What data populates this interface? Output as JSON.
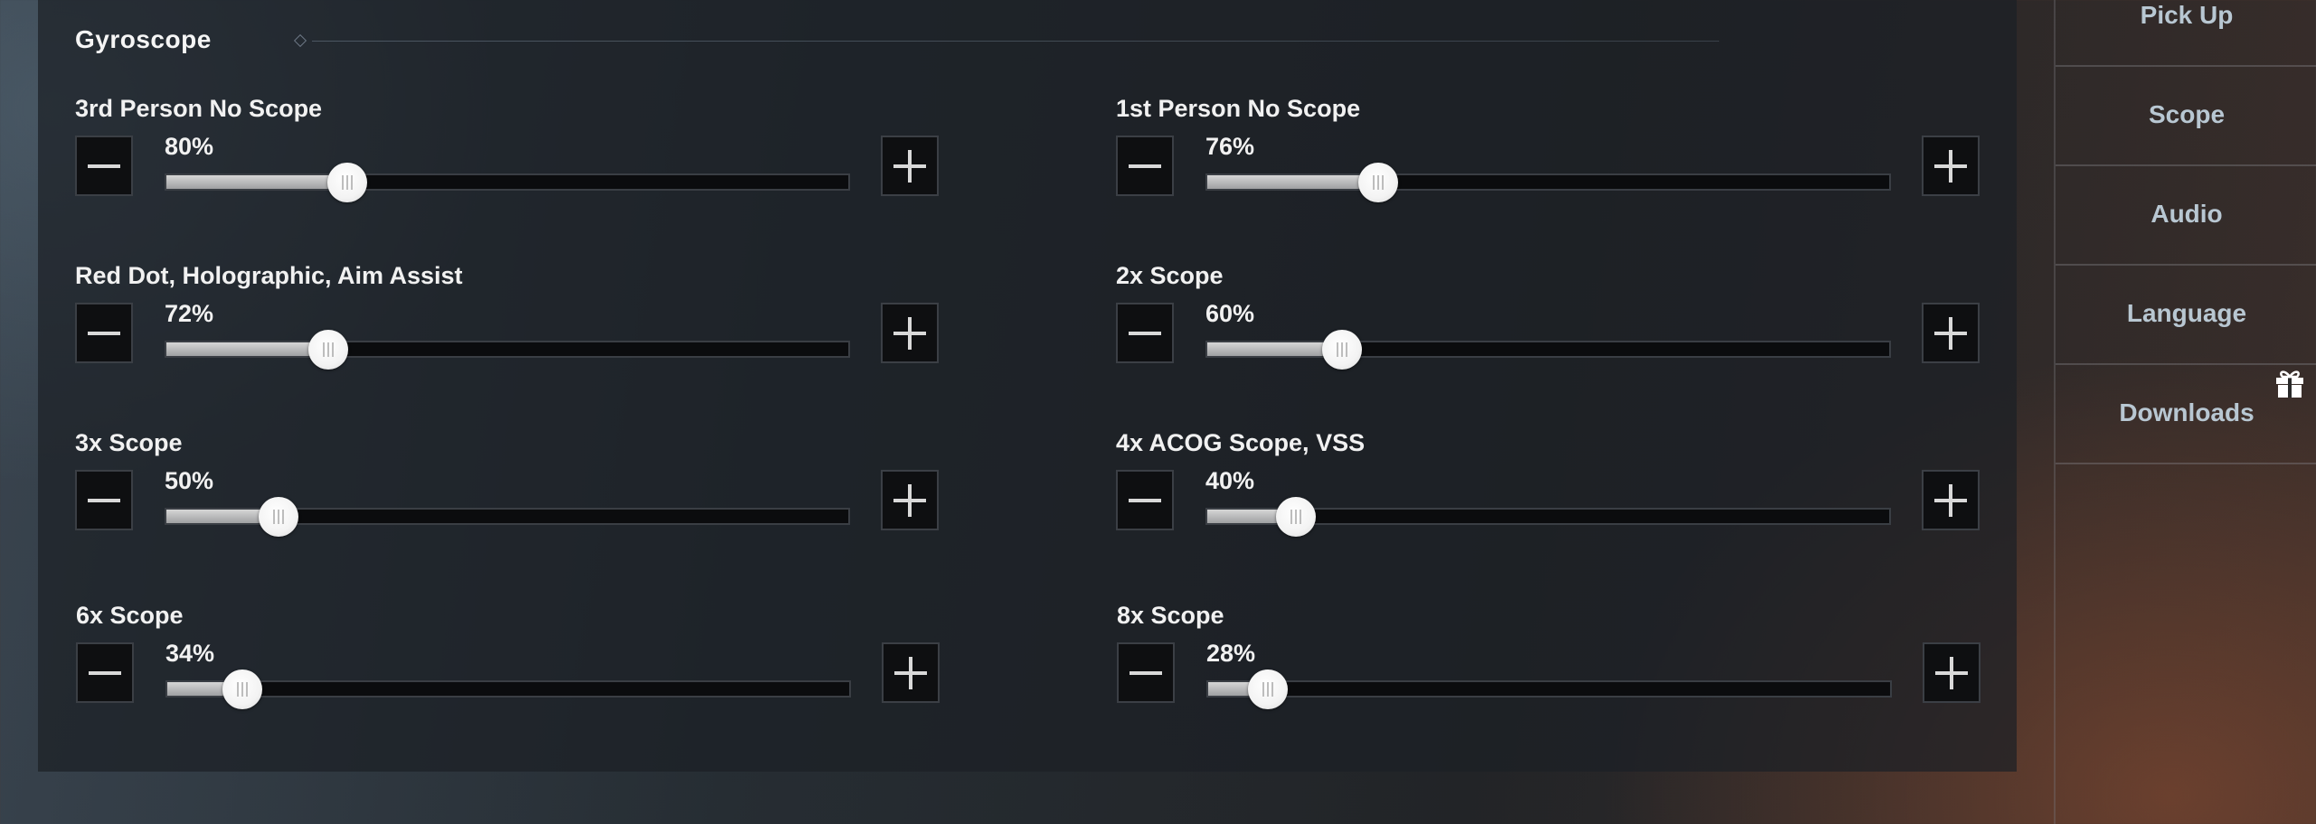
{
  "section": {
    "title": "Gyroscope"
  },
  "settings": [
    {
      "label": "3rd Person No Scope",
      "value": "80%",
      "level": 0.265
    },
    {
      "label": "1st Person No Scope",
      "value": "76%",
      "level": 0.25
    },
    {
      "label": "Red Dot, Holographic, Aim Assist",
      "value": "72%",
      "level": 0.237
    },
    {
      "label": "2x Scope",
      "value": "60%",
      "level": 0.197
    },
    {
      "label": "3x Scope",
      "value": "50%",
      "level": 0.165
    },
    {
      "label": "4x ACOG Scope, VSS",
      "value": "40%",
      "level": 0.13
    },
    {
      "label": "6x Scope",
      "value": "34%",
      "level": 0.11
    },
    {
      "label": "8x Scope",
      "value": "28%",
      "level": 0.088
    }
  ],
  "nav": {
    "items": [
      {
        "label": "Pick Up"
      },
      {
        "label": "Scope"
      },
      {
        "label": "Audio"
      },
      {
        "label": "Language"
      },
      {
        "label": "Downloads"
      }
    ]
  },
  "icons": {
    "minus": "minus-icon",
    "plus": "plus-icon",
    "diamond": "diamond-icon",
    "gift": "gift-icon"
  },
  "colors": {
    "track_fill": "#bfbfbf",
    "nav_text": "#b8c7d2",
    "button_bg": "#0e0f11"
  }
}
